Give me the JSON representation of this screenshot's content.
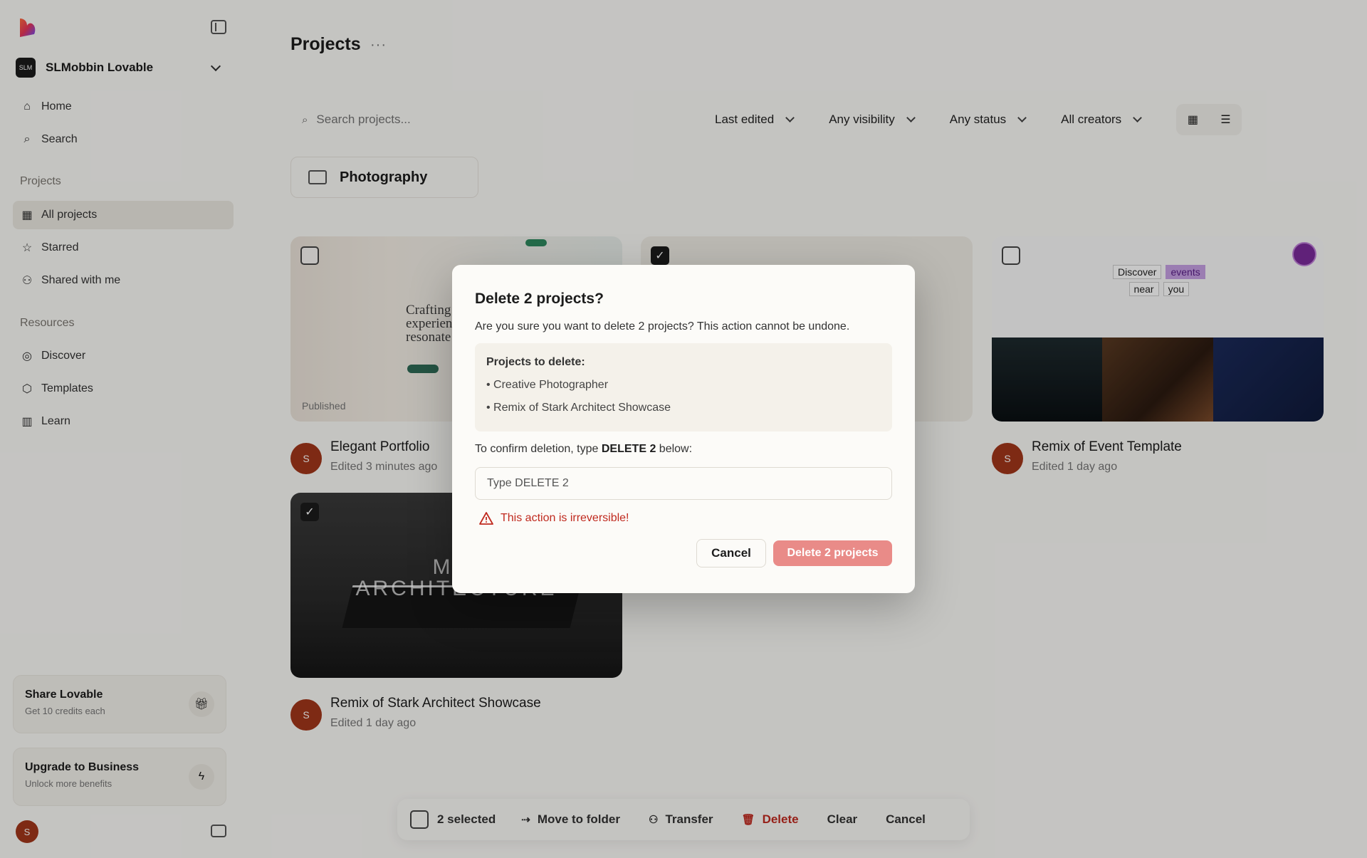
{
  "sidebar": {
    "workspace": {
      "avatar": "SLM",
      "name": "SLMobbin Lovable"
    },
    "nav": [
      {
        "label": "Home",
        "icon": "home-icon"
      },
      {
        "label": "Search",
        "icon": "search-icon"
      }
    ],
    "projects_label": "Projects",
    "projects": [
      {
        "label": "All projects",
        "icon": "grid-icon",
        "active": true
      },
      {
        "label": "Starred",
        "icon": "star-icon"
      },
      {
        "label": "Shared with me",
        "icon": "users-icon"
      }
    ],
    "resources_label": "Resources",
    "resources": [
      {
        "label": "Discover",
        "icon": "compass-icon"
      },
      {
        "label": "Templates",
        "icon": "cube-icon"
      },
      {
        "label": "Learn",
        "icon": "library-icon"
      }
    ],
    "share": {
      "title": "Share Lovable",
      "subtitle": "Get 10 credits each",
      "icon": "gift-icon"
    },
    "upgrade": {
      "title": "Upgrade to Business",
      "subtitle": "Unlock more benefits",
      "icon": "bolt-icon"
    },
    "user_initial": "S"
  },
  "main": {
    "title": "Projects",
    "more_label": "···",
    "search": {
      "placeholder": "Search projects..."
    },
    "filters": [
      "Last edited",
      "Any visibility",
      "Any status",
      "All creators"
    ],
    "folder": {
      "label": "Photography"
    },
    "cards": [
      {
        "title": "Elegant Portfolio",
        "subtitle": "Edited 3 minutes ago",
        "badge": "Published",
        "thumb_text": "Crafting\nexperien\nresonate",
        "checked": false,
        "avatar": "S"
      },
      {
        "title": "Remix of Event Template",
        "subtitle": "Edited 1 day ago",
        "thumb_words": [
          "Discover",
          "events",
          "near",
          "you"
        ],
        "checked": false,
        "avatar": "S"
      },
      {
        "title": "Remix of Stark Architect Showcase",
        "subtitle": "Edited 1 day ago",
        "thumb_text": "MIN\nARCHITECTURE",
        "checked": true,
        "avatar": "S"
      }
    ]
  },
  "modal": {
    "title": "Delete 2 projects?",
    "description": "Are you sure you want to delete 2 projects? This action cannot be undone.",
    "list_heading": "Projects to delete:",
    "items": [
      "• Creative Photographer",
      "• Remix of Stark Architect Showcase"
    ],
    "confirm_prefix": "To confirm deletion, type ",
    "confirm_keyword": "DELETE 2",
    "confirm_suffix": " below:",
    "input_placeholder": "Type DELETE 2",
    "warning": "This action is irreversible!",
    "cancel_label": "Cancel",
    "delete_label": "Delete 2 projects"
  },
  "actionbar": {
    "selected": "2 selected",
    "move": "Move to folder",
    "transfer": "Transfer",
    "delete": "Delete",
    "clear": "Clear",
    "cancel": "Cancel"
  },
  "colors": {
    "danger": "#c02a1f",
    "delete_button": "#e98b88",
    "avatar": "#a2371a"
  }
}
